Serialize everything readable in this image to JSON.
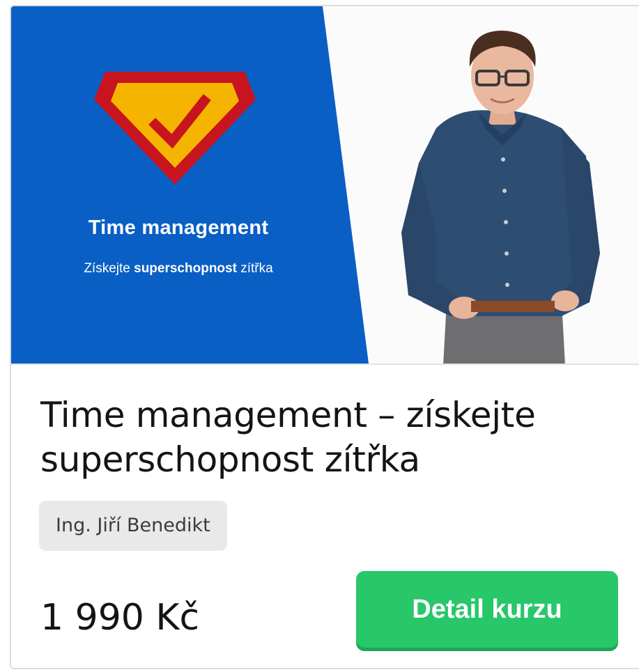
{
  "banner": {
    "title": "Time management",
    "subtitle_pre": "Získejte ",
    "subtitle_bold": "superschopnost",
    "subtitle_post": " zítřka",
    "colors": {
      "blue": "#0a5fc5",
      "shield_red": "#c8141e",
      "shield_yellow": "#f5b400"
    }
  },
  "course": {
    "title": "Time management – získejte superschopnost zítřka",
    "author": "Ing. Jiří Benedikt",
    "price": "1 990 Kč"
  },
  "actions": {
    "detail_label": "Detail kurzu",
    "button_color": "#28c76a"
  },
  "icons": {
    "banner_logo": "superhero-shield-check-icon"
  }
}
